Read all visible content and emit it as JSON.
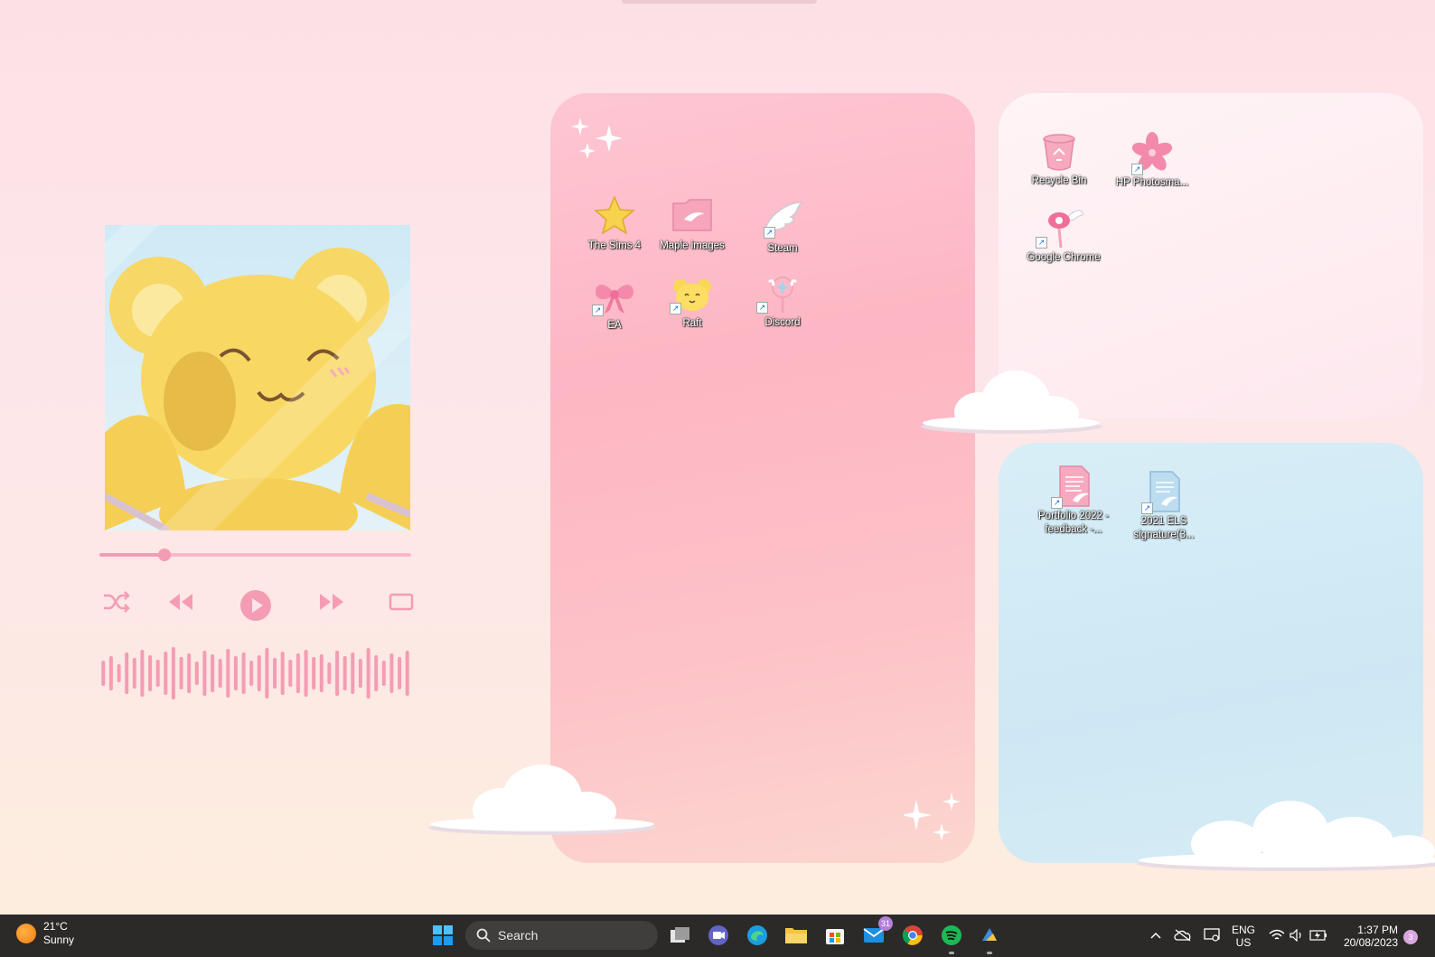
{
  "desktop": {
    "pink_panel_icons": [
      {
        "label": "The Sims 4",
        "icon": "star-icon"
      },
      {
        "label": "Maple images",
        "icon": "folder-wing-icon"
      },
      {
        "label": "Steam",
        "icon": "wing-icon"
      },
      {
        "label": "EA",
        "icon": "bow-icon"
      },
      {
        "label": "Raft",
        "icon": "kero-face-icon"
      },
      {
        "label": "Discord",
        "icon": "magic-wand-icon"
      }
    ],
    "white_panel_icons": [
      {
        "label": "Recycle Bin",
        "icon": "recycle-bin-icon"
      },
      {
        "label": "HP Photosma...",
        "icon": "sakura-icon"
      },
      {
        "label": "Google Chrome",
        "icon": "sealing-wand-icon"
      }
    ],
    "blue_panel_icons": [
      {
        "label": "Portfolio 2022 - feedback -...",
        "icon": "pink-document-icon"
      },
      {
        "label": "2021 ELS signature(3...",
        "icon": "blue-document-icon"
      }
    ]
  },
  "player": {
    "progress": 0.21,
    "controls": [
      "shuffle-icon",
      "previous-icon",
      "play-icon",
      "next-icon",
      "repeat-icon"
    ],
    "accent": "#f49cb4"
  },
  "taskbar": {
    "weather": {
      "temp": "21°C",
      "condition": "Sunny"
    },
    "search_placeholder": "Search",
    "apps": [
      "start-icon",
      "task-view-icon",
      "teams-chat-icon",
      "edge-icon",
      "file-explorer-icon",
      "ms-store-icon",
      "mail-icon",
      "chrome-icon",
      "spotify-icon",
      "app-icon"
    ],
    "mail_badge": "31",
    "lang_line1": "ENG",
    "lang_line2": "US",
    "time": "1:37 PM",
    "date": "20/08/2023",
    "notifications": "3"
  }
}
